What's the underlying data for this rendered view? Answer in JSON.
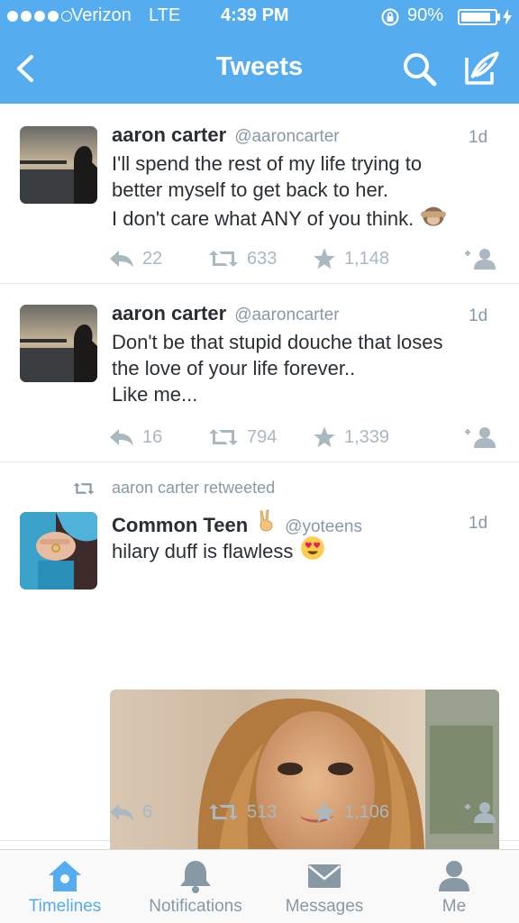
{
  "status_bar": {
    "carrier": "Verizon",
    "network": "LTE",
    "time": "4:39 PM",
    "battery": "90%",
    "battery_level": 0.9,
    "signal_bars": 4,
    "signal_total": 5
  },
  "header": {
    "title": "Tweets",
    "background": "#55acee",
    "back_icon": "chevron-left-icon",
    "search_icon": "search-icon",
    "compose_icon": "compose-icon"
  },
  "tweets": [
    {
      "name": "aaron carter",
      "handle": "@aaroncarter",
      "time": "1d",
      "lines": [
        "I'll spend the rest of my life trying to",
        "better myself to get back to her.",
        "I don't care what ANY of you think."
      ],
      "emoji": "see-no-evil-monkey-emoji",
      "replies": "22",
      "retweets": "633",
      "favorites": "1,148"
    },
    {
      "name": "aaron carter",
      "handle": "@aaroncarter",
      "time": "1d",
      "lines": [
        "Don't be that stupid douche that loses",
        "the love of your life forever..",
        "Like me..."
      ],
      "replies": "16",
      "retweets": "794",
      "favorites": "1,339"
    },
    {
      "retweeted_by": "aaron carter retweeted",
      "name": "Common Teen",
      "name_emoji": "victory-hand-emoji",
      "handle": "@yoteens",
      "time": "1d",
      "lines": [
        "hilary duff is flawless"
      ],
      "emoji": "heart-eyes-emoji",
      "replies": "6",
      "retweets": "513",
      "favorites": "1,106"
    }
  ],
  "tabs": [
    {
      "label": "Timelines",
      "icon": "home-icon",
      "active": true
    },
    {
      "label": "Notifications",
      "icon": "bell-icon",
      "active": false
    },
    {
      "label": "Messages",
      "icon": "envelope-icon",
      "active": false
    },
    {
      "label": "Me",
      "icon": "person-icon",
      "active": false
    }
  ],
  "colors": {
    "brand": "#55acee",
    "text": "#292f33",
    "muted": "#8899a6",
    "action": "#aab8c2",
    "divider": "#e1e8ed"
  }
}
